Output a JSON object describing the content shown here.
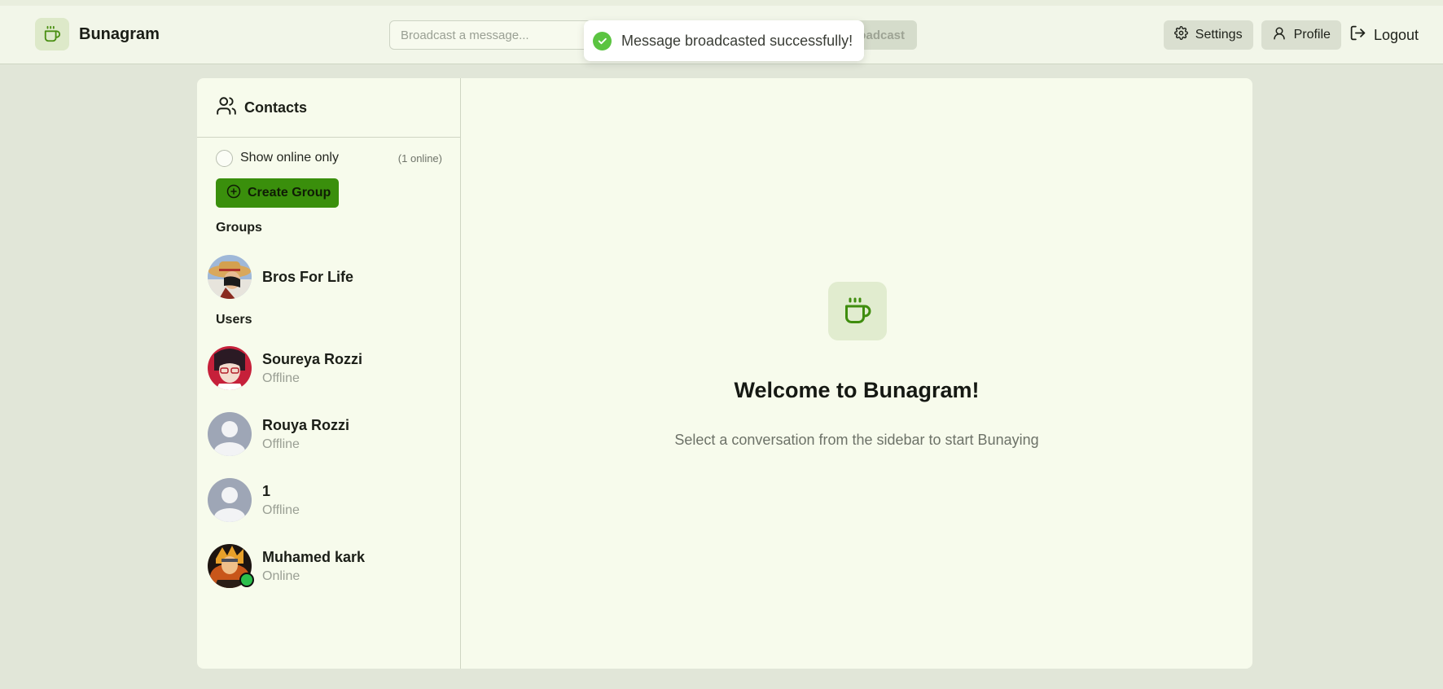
{
  "app": {
    "name": "Bunagram",
    "logo_icon": "coffee-cup-icon",
    "accent_color": "#3a8f0c"
  },
  "header": {
    "broadcast_placeholder": "Broadcast a message...",
    "broadcast_button": "Broadcast",
    "toast": {
      "message": "Message broadcasted successfully!",
      "icon": "check-circle-icon",
      "color": "#5bc441"
    },
    "settings_label": "Settings",
    "profile_label": "Profile",
    "logout_label": "Logout"
  },
  "sidebar": {
    "title": "Contacts",
    "show_online_label": "Show online only",
    "online_count": "(1 online)",
    "create_group_label": "Create Group",
    "groups_label": "Groups",
    "users_label": "Users",
    "groups": [
      {
        "name": "Bros For Life",
        "avatar": "group-photo"
      }
    ],
    "users": [
      {
        "name": "Soureya Rozzi",
        "status": "Offline",
        "avatar": "photo"
      },
      {
        "name": "Rouya Rozzi",
        "status": "Offline",
        "avatar": "default"
      },
      {
        "name": "1",
        "status": "Offline",
        "avatar": "default"
      },
      {
        "name": "Muhamed kark",
        "status": "Online",
        "avatar": "photo"
      }
    ]
  },
  "main": {
    "welcome_title": "Welcome to Bunagram!",
    "welcome_subtitle": "Select a conversation from the sidebar to start Bunaying"
  }
}
